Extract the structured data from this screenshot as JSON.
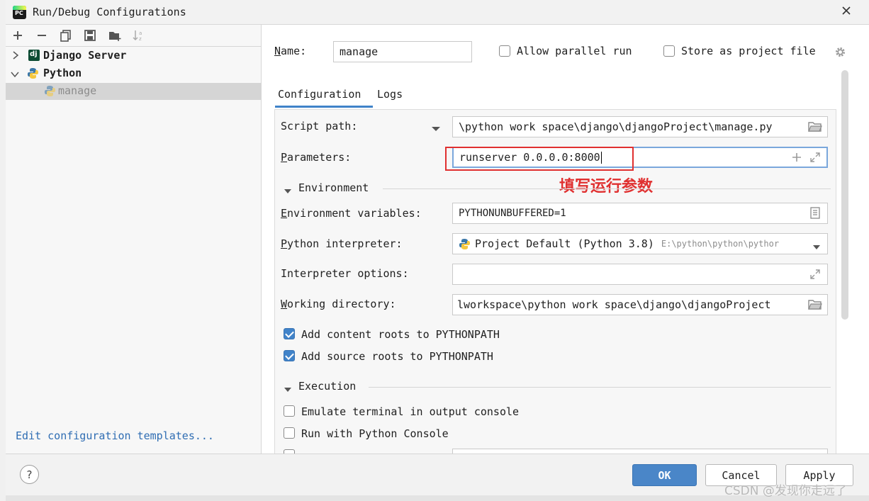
{
  "window": {
    "title": "Run/Debug Configurations"
  },
  "tree": {
    "items": [
      {
        "label": "Django Server"
      },
      {
        "label": "Python"
      },
      {
        "label": "manage"
      }
    ],
    "edit_templates_link": "Edit configuration templates..."
  },
  "header": {
    "name_label": "Name:",
    "name_value": "manage",
    "allow_parallel_label": "Allow parallel run",
    "store_project_label": "Store as project file"
  },
  "tabs": [
    {
      "label": "Configuration"
    },
    {
      "label": "Logs"
    }
  ],
  "form": {
    "script_path_label": "Script path:",
    "script_path_value": "\\python work space\\django\\djangoProject\\manage.py",
    "parameters_label": "Parameters:",
    "parameters_value": "runserver 0.0.0.0:8000",
    "annotation": "填写运行参数",
    "environment_section": "Environment",
    "env_vars_label": "Environment variables:",
    "env_vars_value": "PYTHONUNBUFFERED=1",
    "interpreter_label": "Python interpreter:",
    "interpreter_value": "Project Default (Python 3.8)",
    "interpreter_path": "E:\\python\\python\\pythor",
    "interp_options_label": "Interpreter options:",
    "interp_options_value": "",
    "working_dir_label": "Working directory:",
    "working_dir_value": "lworkspace\\python work space\\django\\djangoProject",
    "content_roots_label": "Add content roots to PYTHONPATH",
    "source_roots_label": "Add source roots to PYTHONPATH",
    "execution_section": "Execution",
    "emulate_terminal_label": "Emulate terminal in output console",
    "python_console_label": "Run with Python Console"
  },
  "footer": {
    "help_label": "?",
    "ok_label": "OK",
    "cancel_label": "Cancel",
    "apply_label": "Apply"
  },
  "watermark": "CSDN @发现你走远了",
  "colors": {
    "accent": "#4083c9",
    "selection": "#d5d5d5",
    "annotation": "#e03030",
    "link": "#2f6db3"
  }
}
